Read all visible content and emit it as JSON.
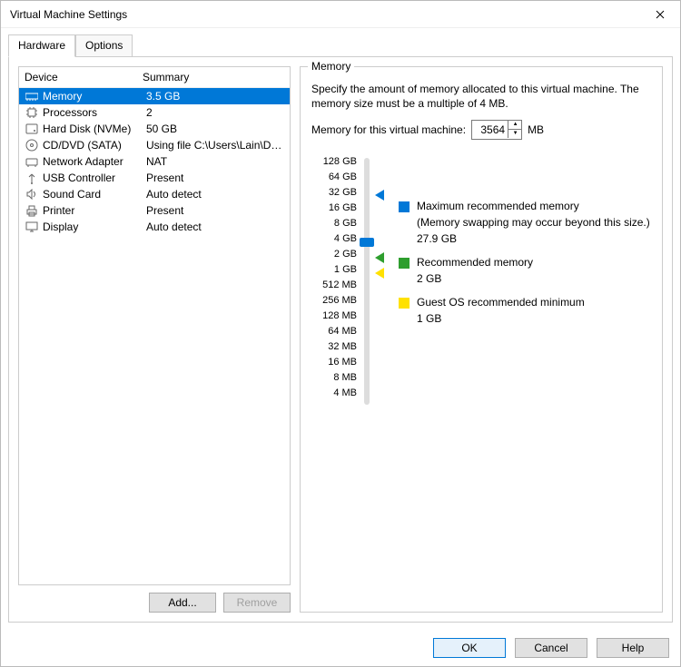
{
  "window": {
    "title": "Virtual Machine Settings"
  },
  "tabs": {
    "hardware": "Hardware",
    "options": "Options"
  },
  "devlist": {
    "header_device": "Device",
    "header_summary": "Summary",
    "rows": [
      {
        "name": "Memory",
        "summary": "3.5 GB",
        "icon": "memory-icon"
      },
      {
        "name": "Processors",
        "summary": "2",
        "icon": "cpu-icon"
      },
      {
        "name": "Hard Disk (NVMe)",
        "summary": "50 GB",
        "icon": "disk-icon"
      },
      {
        "name": "CD/DVD (SATA)",
        "summary": "Using file C:\\Users\\Lain\\Desk...",
        "icon": "cd-icon"
      },
      {
        "name": "Network Adapter",
        "summary": "NAT",
        "icon": "network-icon"
      },
      {
        "name": "USB Controller",
        "summary": "Present",
        "icon": "usb-icon"
      },
      {
        "name": "Sound Card",
        "summary": "Auto detect",
        "icon": "sound-icon"
      },
      {
        "name": "Printer",
        "summary": "Present",
        "icon": "printer-icon"
      },
      {
        "name": "Display",
        "summary": "Auto detect",
        "icon": "display-icon"
      }
    ],
    "add_label": "Add...",
    "remove_label": "Remove"
  },
  "memory": {
    "group_label": "Memory",
    "description": "Specify the amount of memory allocated to this virtual machine. The memory size must be a multiple of 4 MB.",
    "field_label": "Memory for this virtual machine:",
    "value": "3564",
    "unit": "MB",
    "ticks": [
      "128 GB",
      "64 GB",
      "32 GB",
      "16 GB",
      "8 GB",
      "4 GB",
      "2 GB",
      "1 GB",
      "512 MB",
      "256 MB",
      "128 MB",
      "64 MB",
      "32 MB",
      "16 MB",
      "8 MB",
      "4 MB"
    ],
    "legend": {
      "max_label": "Maximum recommended memory",
      "max_note": "(Memory swapping may occur beyond this size.)",
      "max_value": "27.9 GB",
      "rec_label": "Recommended memory",
      "rec_value": "2 GB",
      "min_label": "Guest OS recommended minimum",
      "min_value": "1 GB"
    }
  },
  "footer": {
    "ok": "OK",
    "cancel": "Cancel",
    "help": "Help"
  },
  "colors": {
    "accent": "#0078d7",
    "green": "#2e9e2e",
    "yellow": "#ffe100"
  }
}
